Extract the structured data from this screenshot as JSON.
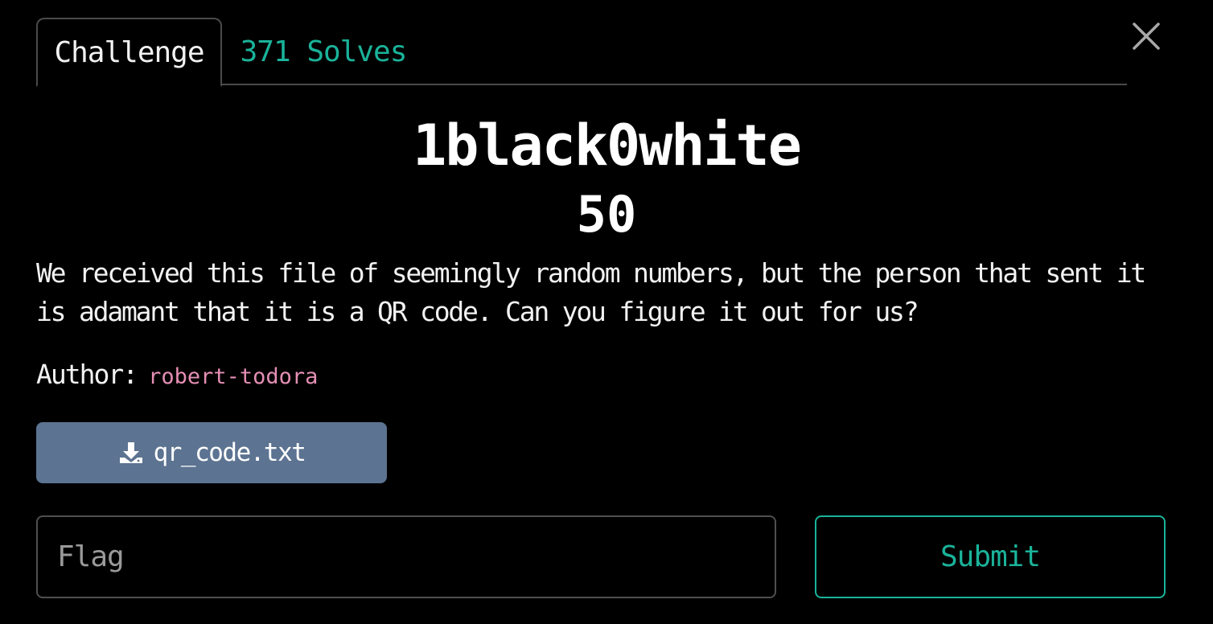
{
  "tabs": [
    {
      "label": "Challenge",
      "active": true
    },
    {
      "label": "371 Solves",
      "active": false
    }
  ],
  "close": {
    "icon": "close-icon"
  },
  "challenge": {
    "name": "1black0white",
    "value": "50",
    "description": "We received this file of seemingly random numbers, but the person that sent it is adamant that it is a QR code. Can you figure it out for us?",
    "author_label": "Author:",
    "author": "robert-todora"
  },
  "file": {
    "label": "qr_code.txt",
    "icon": "download-icon"
  },
  "flag": {
    "placeholder": "Flag",
    "value": ""
  },
  "submit": {
    "label": "Submit"
  },
  "colors": {
    "background": "#000000",
    "accent": "#1ab39a",
    "author": "#e58fb4",
    "download_button": "#5c7391",
    "border": "#4a4a4a"
  }
}
